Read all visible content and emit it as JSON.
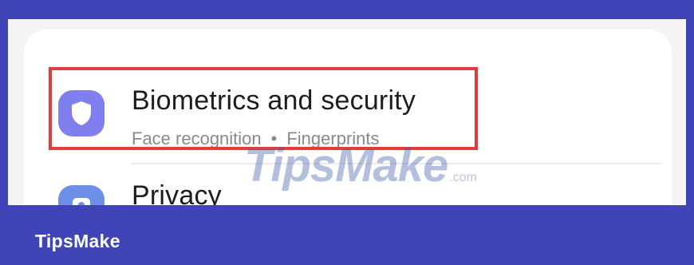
{
  "settings": {
    "items": [
      {
        "icon": "shield-icon",
        "icon_color": "#7f7fef",
        "title": "Biometrics and security",
        "subtitle_parts": [
          "Face recognition",
          "Fingerprints"
        ],
        "separator": "•",
        "highlighted": true
      },
      {
        "icon": "privacy-icon",
        "icon_color": "#6d8fe8",
        "title": "Privacy"
      }
    ]
  },
  "watermark": {
    "text": "TipsMake",
    "suffix": ".com"
  },
  "footer": {
    "brand": "TipsMake"
  },
  "colors": {
    "frame": "#3f45b6",
    "highlight_border": "#e53b3b",
    "title_text": "#1d1d1f",
    "subtitle_text": "#8a8a8e"
  }
}
